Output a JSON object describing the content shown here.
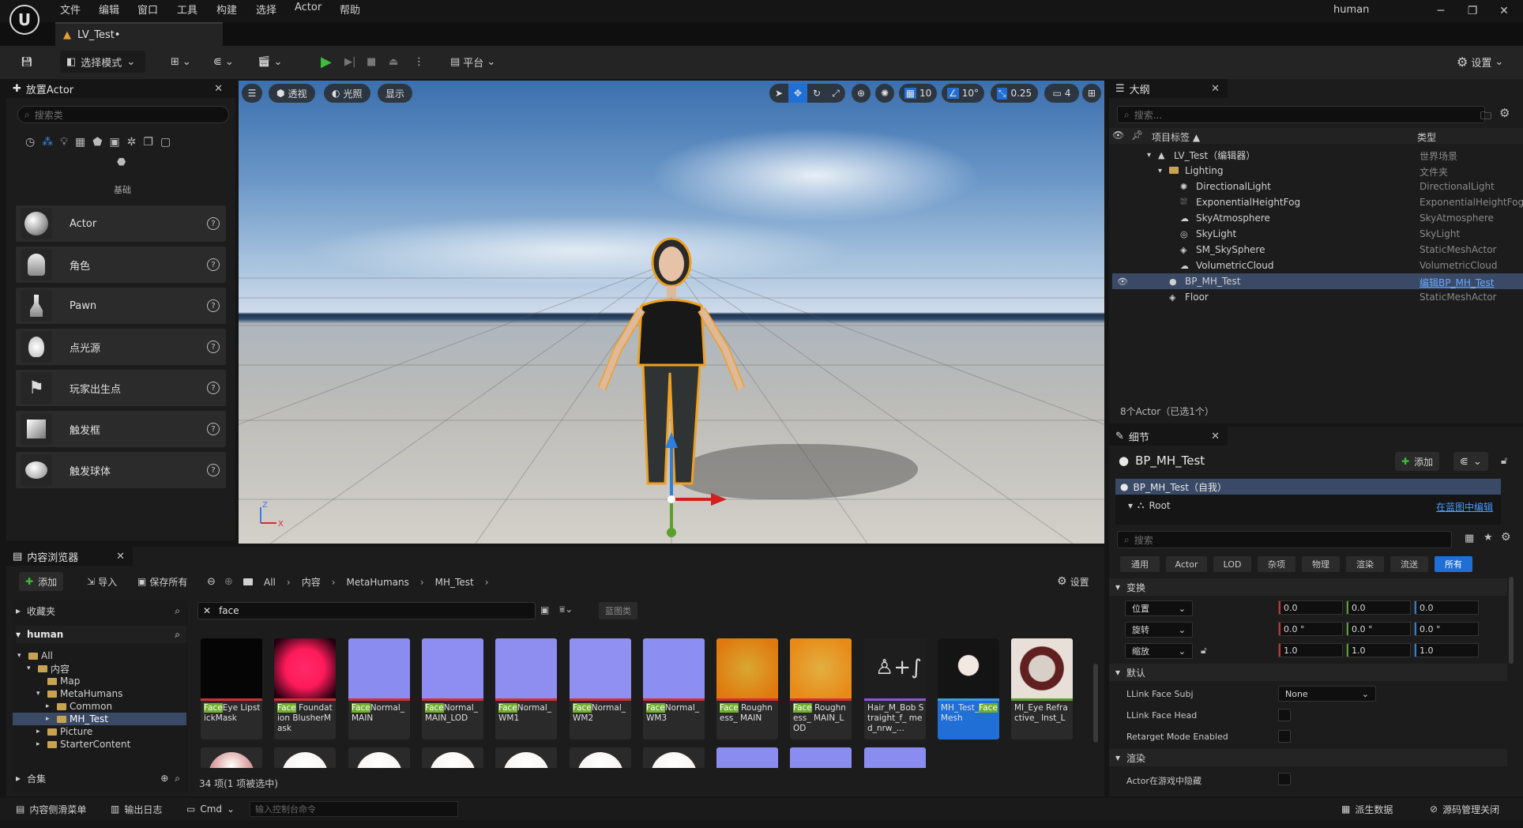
{
  "menu": [
    "文件",
    "编辑",
    "窗口",
    "工具",
    "构建",
    "选择",
    "Actor",
    "帮助"
  ],
  "project_name": "human",
  "level_tab": "LV_Test•",
  "toolbar": {
    "mode_label": "选择模式",
    "platform_label": "平台",
    "settings_label": "设置"
  },
  "place_actors": {
    "tab_title": "放置Actor",
    "search_placeholder": "搜索类",
    "category_label": "基础",
    "items": [
      {
        "label": "Actor",
        "icon": "sphere-icon"
      },
      {
        "label": "角色",
        "icon": "character-icon"
      },
      {
        "label": "Pawn",
        "icon": "pawn-icon"
      },
      {
        "label": "点光源",
        "icon": "point-light-icon"
      },
      {
        "label": "玩家出生点",
        "icon": "player-start-icon"
      },
      {
        "label": "触发框",
        "icon": "trigger-box-icon"
      },
      {
        "label": "触发球体",
        "icon": "trigger-sphere-icon"
      }
    ]
  },
  "viewport": {
    "perspective_label": "透视",
    "lighting_label": "光照",
    "show_label": "显示",
    "grid_snap": "10",
    "rotation_snap": "10°",
    "scale_snap": "0.25",
    "camera_speed": "4"
  },
  "outliner": {
    "tab_title": "大纲",
    "search_placeholder": "搜索...",
    "col_label": "项目标签",
    "col_type": "类型",
    "rows": [
      {
        "label": "LV_Test（编辑器）",
        "type": "世界场景",
        "indent": 0
      },
      {
        "label": "Lighting",
        "type": "文件夹",
        "indent": 1
      },
      {
        "label": "DirectionalLight",
        "type": "DirectionalLight",
        "indent": 2
      },
      {
        "label": "ExponentialHeightFog",
        "type": "ExponentialHeightFog",
        "indent": 2
      },
      {
        "label": "SkyAtmosphere",
        "type": "SkyAtmosphere",
        "indent": 2
      },
      {
        "label": "SkyLight",
        "type": "SkyLight",
        "indent": 2
      },
      {
        "label": "SM_SkySphere",
        "type": "StaticMeshActor",
        "indent": 2
      },
      {
        "label": "VolumetricCloud",
        "type": "VolumetricCloud",
        "indent": 2
      },
      {
        "label": "BP_MH_Test",
        "type": "编辑BP_MH_Test",
        "indent": 1,
        "selected": true
      },
      {
        "label": "Floor",
        "type": "StaticMeshActor",
        "indent": 1
      }
    ],
    "status": "8个Actor（已选1个）"
  },
  "details": {
    "tab_title": "细节",
    "object_name": "BP_MH_Test",
    "add_label": "添加",
    "self_row": "BP_MH_Test（自我）",
    "root_label": "Root",
    "edit_in_bp": "在蓝图中编辑",
    "search_placeholder": "搜索",
    "tabs": [
      "通用",
      "Actor",
      "LOD",
      "杂项",
      "物理",
      "渲染",
      "流送",
      "所有"
    ],
    "transform_header": "变换",
    "location_label": "位置",
    "rotation_label": "旋转",
    "scale_label": "缩放",
    "location": [
      "0.0",
      "0.0",
      "0.0"
    ],
    "rotation": [
      "0.0 °",
      "0.0 °",
      "0.0 °"
    ],
    "scale": [
      "1.0",
      "1.0",
      "1.0"
    ],
    "default_header": "默认",
    "llink_subj_label": "LLink Face Subj",
    "llink_subj_value": "None",
    "llink_head_label": "LLink Face Head",
    "retarget_label": "Retarget Mode Enabled",
    "render_header": "渲染",
    "hidden_label": "Actor在游戏中隐藏"
  },
  "content_browser": {
    "tab_title": "内容浏览器",
    "add_label": "添加",
    "import_label": "导入",
    "save_all_label": "保存所有",
    "breadcrumb": [
      "All",
      "内容",
      "MetaHumans",
      "MH_Test"
    ],
    "settings_label": "设置",
    "favorites_label": "收藏夹",
    "project_label": "human",
    "collections_label": "合集",
    "filter_text": "face",
    "filter_chip": "蓝图类",
    "tree": [
      {
        "label": "All",
        "indent": 0
      },
      {
        "label": "内容",
        "indent": 1
      },
      {
        "label": "Map",
        "indent": 2
      },
      {
        "label": "MetaHumans",
        "indent": 2
      },
      {
        "label": "Common",
        "indent": 3
      },
      {
        "label": "MH_Test",
        "indent": 3,
        "selected": true
      },
      {
        "label": "Picture",
        "indent": 2
      },
      {
        "label": "StarterContent",
        "indent": 2
      }
    ],
    "assets": [
      {
        "hl": "Face",
        "rest": "Eye LipstickMask"
      },
      {
        "hl": "Face",
        "rest": " Foundation BlusherMask"
      },
      {
        "hl": "Face",
        "rest": "Normal_ MAIN"
      },
      {
        "hl": "Face",
        "rest": "Normal_ MAIN_LOD"
      },
      {
        "hl": "Face",
        "rest": "Normal_ WM1"
      },
      {
        "hl": "Face",
        "rest": "Normal_ WM2"
      },
      {
        "hl": "Face",
        "rest": "Normal_ WM3"
      },
      {
        "hl": "Face",
        "rest": " Roughness_ MAIN"
      },
      {
        "hl": "Face",
        "rest": " Roughness_ MAIN_LOD"
      },
      {
        "hl": "",
        "rest": "Hair_M_Bob Straight_f_ med_nrw_..."
      },
      {
        "pre": "MH_Test_",
        "hl": "Face",
        "rest": " Mesh"
      },
      {
        "hl": "",
        "rest": "MI_Eye Refractive_ Inst_L"
      }
    ],
    "count_text": "34 项(1 项被选中)"
  },
  "statusbar": {
    "drawer": "内容侧滑菜单",
    "output_log": "输出日志",
    "cmd": "Cmd",
    "console_placeholder": "输入控制台命令",
    "derived_data": "派生数据",
    "source_control": "源码管理关闭"
  },
  "colors": {
    "accent": "#1f6fd6",
    "selection_outline": "#f0a020",
    "play": "#3cbf3c",
    "highlight_face": "#6fae2e"
  }
}
